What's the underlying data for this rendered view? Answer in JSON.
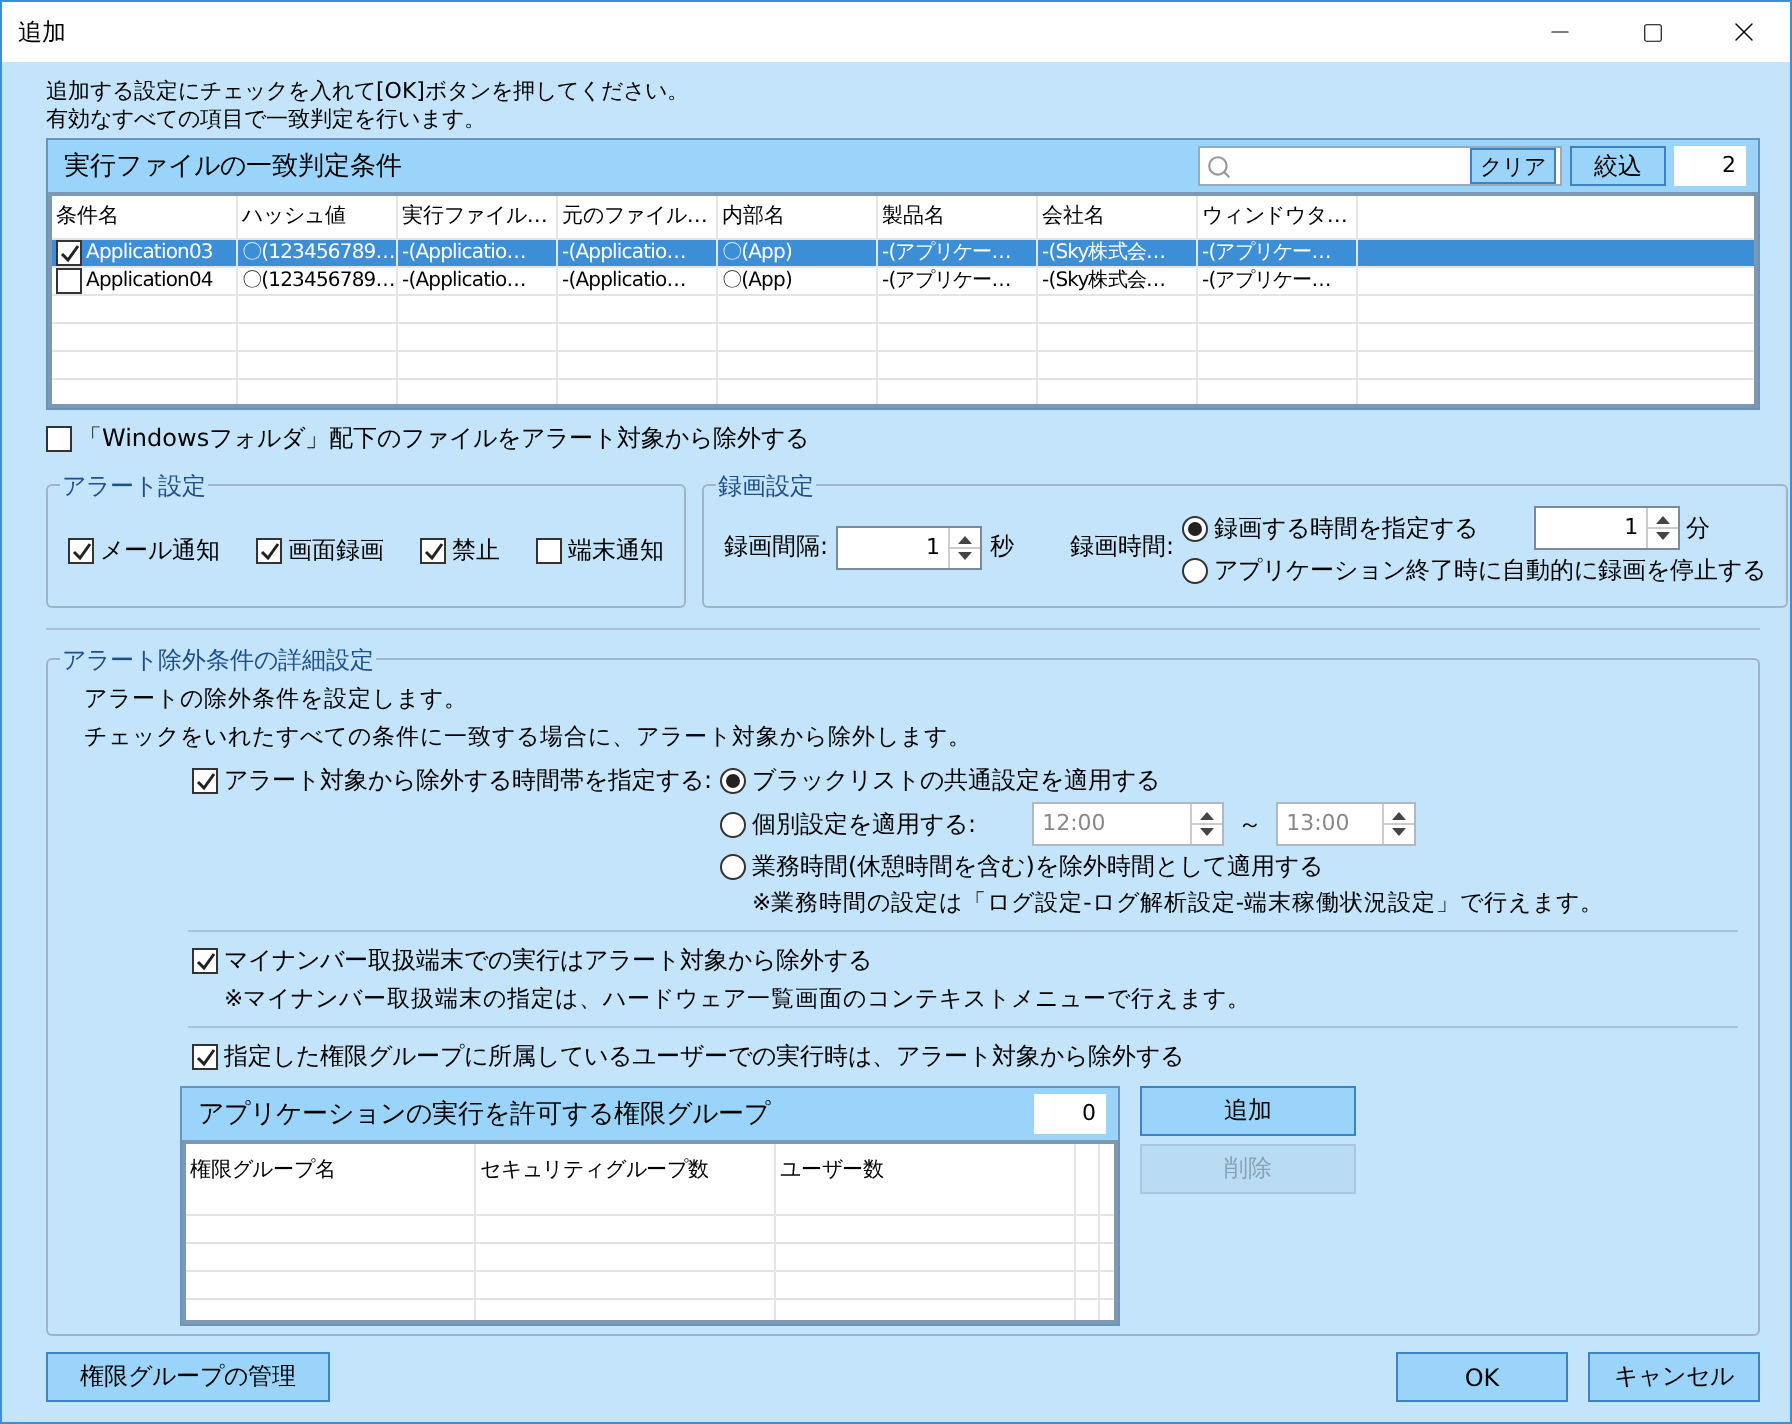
{
  "window": {
    "title": "追加"
  },
  "instructions": [
    "追加する設定にチェックを入れて[OK]ボタンを押してください。",
    "有効なすべての項目で一致判定を行います。"
  ],
  "match_panel": {
    "title": "実行ファイルの一致判定条件",
    "clear_button": "クリア",
    "filter_button": "絞込",
    "count": "2",
    "columns": [
      "条件名",
      "ハッシュ値",
      "実行ファイル…",
      "元のファイル…",
      "内部名",
      "製品名",
      "会社名",
      "ウィンドウタ…"
    ],
    "rows": [
      {
        "checked": true,
        "selected": true,
        "cells": [
          "Application03",
          "〇(123456789…",
          "-(Applicatio…",
          "-(Applicatio…",
          "〇(App)",
          "-(アプリケー…",
          "-(Sky株式会…",
          "-(アプリケー…"
        ]
      },
      {
        "checked": false,
        "selected": false,
        "cells": [
          "Application04",
          "〇(123456789…",
          "-(Applicatio…",
          "-(Applicatio…",
          "〇(App)",
          "-(アプリケー…",
          "-(Sky株式会…",
          "-(アプリケー…"
        ]
      }
    ]
  },
  "exclude_windows_folder": {
    "label": "「Windowsフォルダ」配下のファイルをアラート対象から除外する",
    "checked": false
  },
  "alert_settings": {
    "title": "アラート設定",
    "options": [
      {
        "label": "メール通知",
        "checked": true
      },
      {
        "label": "画面録画",
        "checked": true
      },
      {
        "label": "禁止",
        "checked": true
      },
      {
        "label": "端末通知",
        "checked": false
      }
    ]
  },
  "recording": {
    "title": "録画設定",
    "interval_label": "録画間隔:",
    "interval_value": "1",
    "interval_unit": "秒",
    "duration_label": "録画時間:",
    "options": [
      {
        "kind": "spin",
        "label": "録画する時間を指定する",
        "selected": true,
        "value": "1",
        "unit": "分"
      },
      {
        "kind": "plain",
        "label": "アプリケーション終了時に自動的に録画を停止する",
        "selected": false
      }
    ]
  },
  "exclusion": {
    "title": "アラート除外条件の詳細設定",
    "description": [
      "アラートの除外条件を設定します。",
      "チェックをいれたすべての条件に一致する場合に、アラート対象から除外します。"
    ],
    "time_rule": {
      "label": "アラート対象から除外する時間帯を指定する:",
      "checked": true,
      "options": [
        {
          "kind": "plain",
          "label": "ブラックリストの共通設定を適用する",
          "selected": true
        },
        {
          "kind": "range",
          "label": "個別設定を適用する:",
          "selected": false,
          "from": "12:00",
          "separator": "～",
          "to": "13:00"
        },
        {
          "kind": "note",
          "label": "業務時間(休憩時間を含む)を除外時間として適用する",
          "selected": false,
          "note": "※業務時間の設定は「ログ設定-ログ解析設定-端末稼働状況設定」で行えます。"
        }
      ]
    },
    "mynumber_rule": {
      "label": "マイナンバー取扱端末での実行はアラート対象から除外する",
      "checked": true,
      "note": "※マイナンバー取扱端末の指定は、ハードウェア一覧画面のコンテキストメニューで行えます。"
    },
    "group_rule": {
      "label": "指定した権限グループに所属しているユーザーでの実行時は、アラート対象から除外する",
      "checked": true
    },
    "group_panel": {
      "title": "アプリケーションの実行を許可する権限グループ",
      "count": "0",
      "columns": [
        "権限グループ名",
        "セキュリティグループ数",
        "ユーザー数"
      ]
    },
    "add_button": {
      "label": "追加",
      "disabled": false
    },
    "delete_button": {
      "label": "削除",
      "disabled": true
    }
  },
  "footer": {
    "manage_button": "権限グループの管理",
    "ok_button": "OK",
    "cancel_button": "キャンセル"
  }
}
